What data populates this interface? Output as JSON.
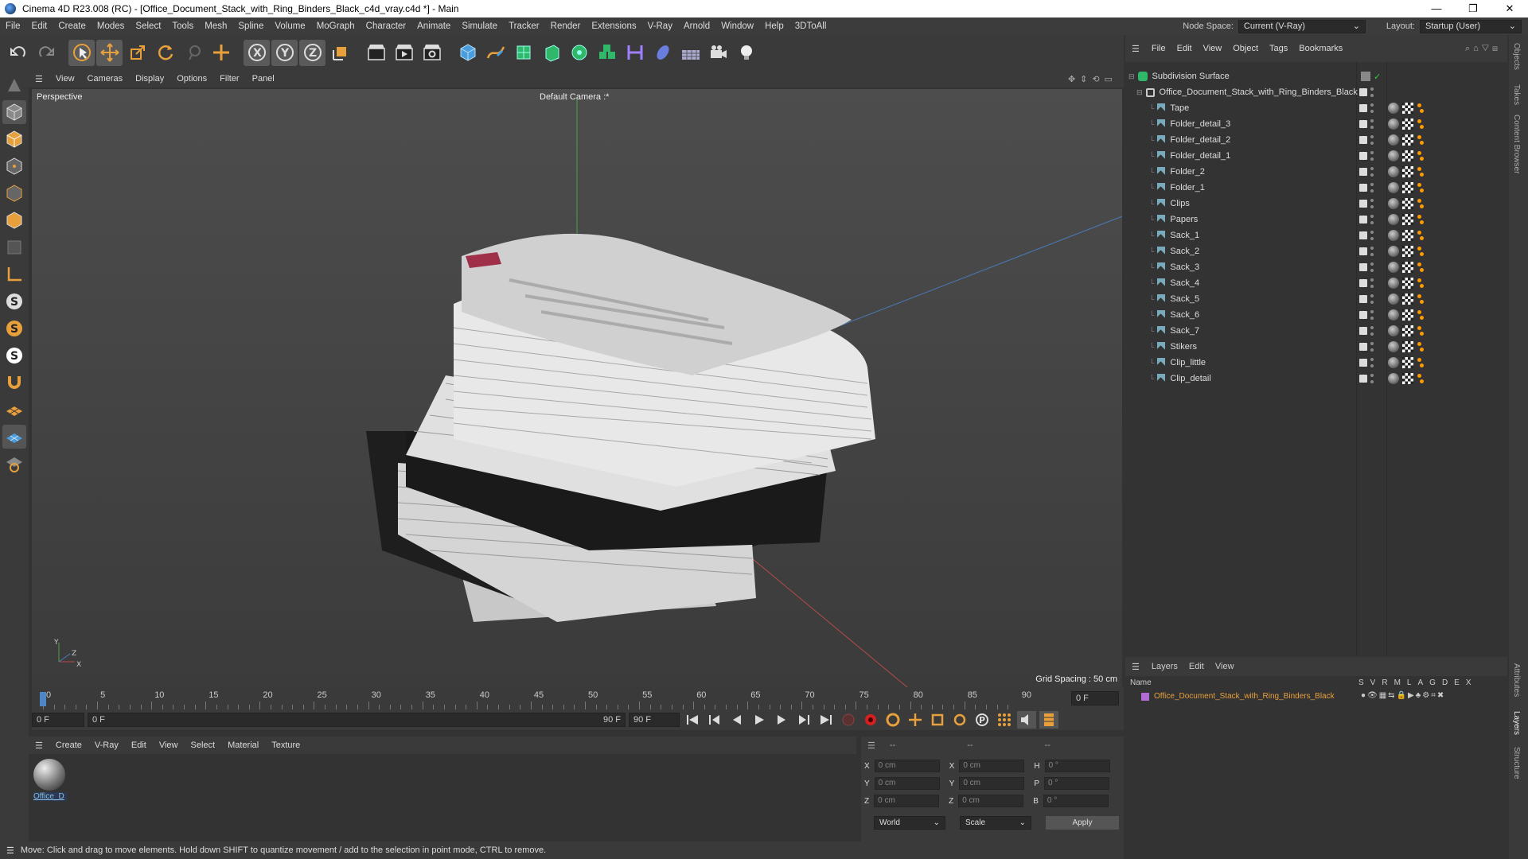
{
  "window": {
    "title": "Cinema 4D R23.008 (RC) - [Office_Document_Stack_with_Ring_Binders_Black_c4d_vray.c4d *] - Main",
    "controls": [
      "—",
      "❐",
      "✕"
    ]
  },
  "menubar": {
    "items": [
      "File",
      "Edit",
      "Create",
      "Modes",
      "Select",
      "Tools",
      "Mesh",
      "Spline",
      "Volume",
      "MoGraph",
      "Character",
      "Animate",
      "Simulate",
      "Tracker",
      "Render",
      "Extensions",
      "V-Ray",
      "Arnold",
      "Window",
      "Help",
      "3DToAll"
    ],
    "node_space_label": "Node Space:",
    "node_space_value": "Current (V-Ray)",
    "layout_label": "Layout:",
    "layout_value": "Startup (User)"
  },
  "viewport": {
    "menu": [
      "View",
      "Cameras",
      "Display",
      "Options",
      "Filter",
      "Panel"
    ],
    "label": "Perspective",
    "camera": "Default Camera :*",
    "grid_spacing": "Grid Spacing : 50 cm"
  },
  "timeline": {
    "ticks": [
      "0",
      "5",
      "10",
      "15",
      "20",
      "25",
      "30",
      "35",
      "40",
      "45",
      "50",
      "55",
      "60",
      "65",
      "70",
      "75",
      "80",
      "85",
      "90"
    ],
    "end_field": "0 F",
    "start": "0 F",
    "range_start": "0 F",
    "range_end": "90 F",
    "max": "90 F"
  },
  "material_manager": {
    "menu": [
      "Create",
      "V-Ray",
      "Edit",
      "View",
      "Select",
      "Material",
      "Texture"
    ],
    "material_name": "Office_D"
  },
  "coords": {
    "header": [
      "--",
      "--",
      "--"
    ],
    "rows": [
      {
        "a": "X",
        "av": "0 cm",
        "b": "X",
        "bv": "0 cm",
        "c": "H",
        "cv": "0 °"
      },
      {
        "a": "Y",
        "av": "0 cm",
        "b": "Y",
        "bv": "0 cm",
        "c": "P",
        "cv": "0 °"
      },
      {
        "a": "Z",
        "av": "0 cm",
        "b": "Z",
        "bv": "0 cm",
        "c": "B",
        "cv": "0 °"
      }
    ],
    "mode1": "World",
    "mode2": "Scale",
    "apply": "Apply"
  },
  "statusbar": {
    "text": "Move: Click and drag to move elements. Hold down SHIFT to quantize movement / add to the selection in point mode, CTRL to remove."
  },
  "object_manager": {
    "menu": [
      "File",
      "Edit",
      "View",
      "Object",
      "Tags",
      "Bookmarks"
    ],
    "root": "Subdivision Surface",
    "group": "Office_Document_Stack_with_Ring_Binders_Black",
    "children": [
      "Tape",
      "Folder_detail_3",
      "Folder_detail_2",
      "Folder_detail_1",
      "Folder_2",
      "Folder_1",
      "Clips",
      "Papers",
      "Sack_1",
      "Sack_2",
      "Sack_3",
      "Sack_4",
      "Sack_5",
      "Sack_6",
      "Sack_7",
      "Stikers",
      "Clip_little",
      "Clip_detail"
    ]
  },
  "layer_manager": {
    "menu": [
      "Layers",
      "Edit",
      "View"
    ],
    "name_header": "Name",
    "cols": [
      "S",
      "V",
      "R",
      "M",
      "L",
      "A",
      "G",
      "D",
      "E",
      "X"
    ],
    "layer_name": "Office_Document_Stack_with_Ring_Binders_Black",
    "layer_color": "#b06cd0"
  },
  "right_tabs": [
    "Objects",
    "Takes",
    "Content Browser",
    "Attributes",
    "Layers",
    "Structure"
  ],
  "colors": {
    "accent": "#e8a03c",
    "selection": "#4f86c6"
  }
}
